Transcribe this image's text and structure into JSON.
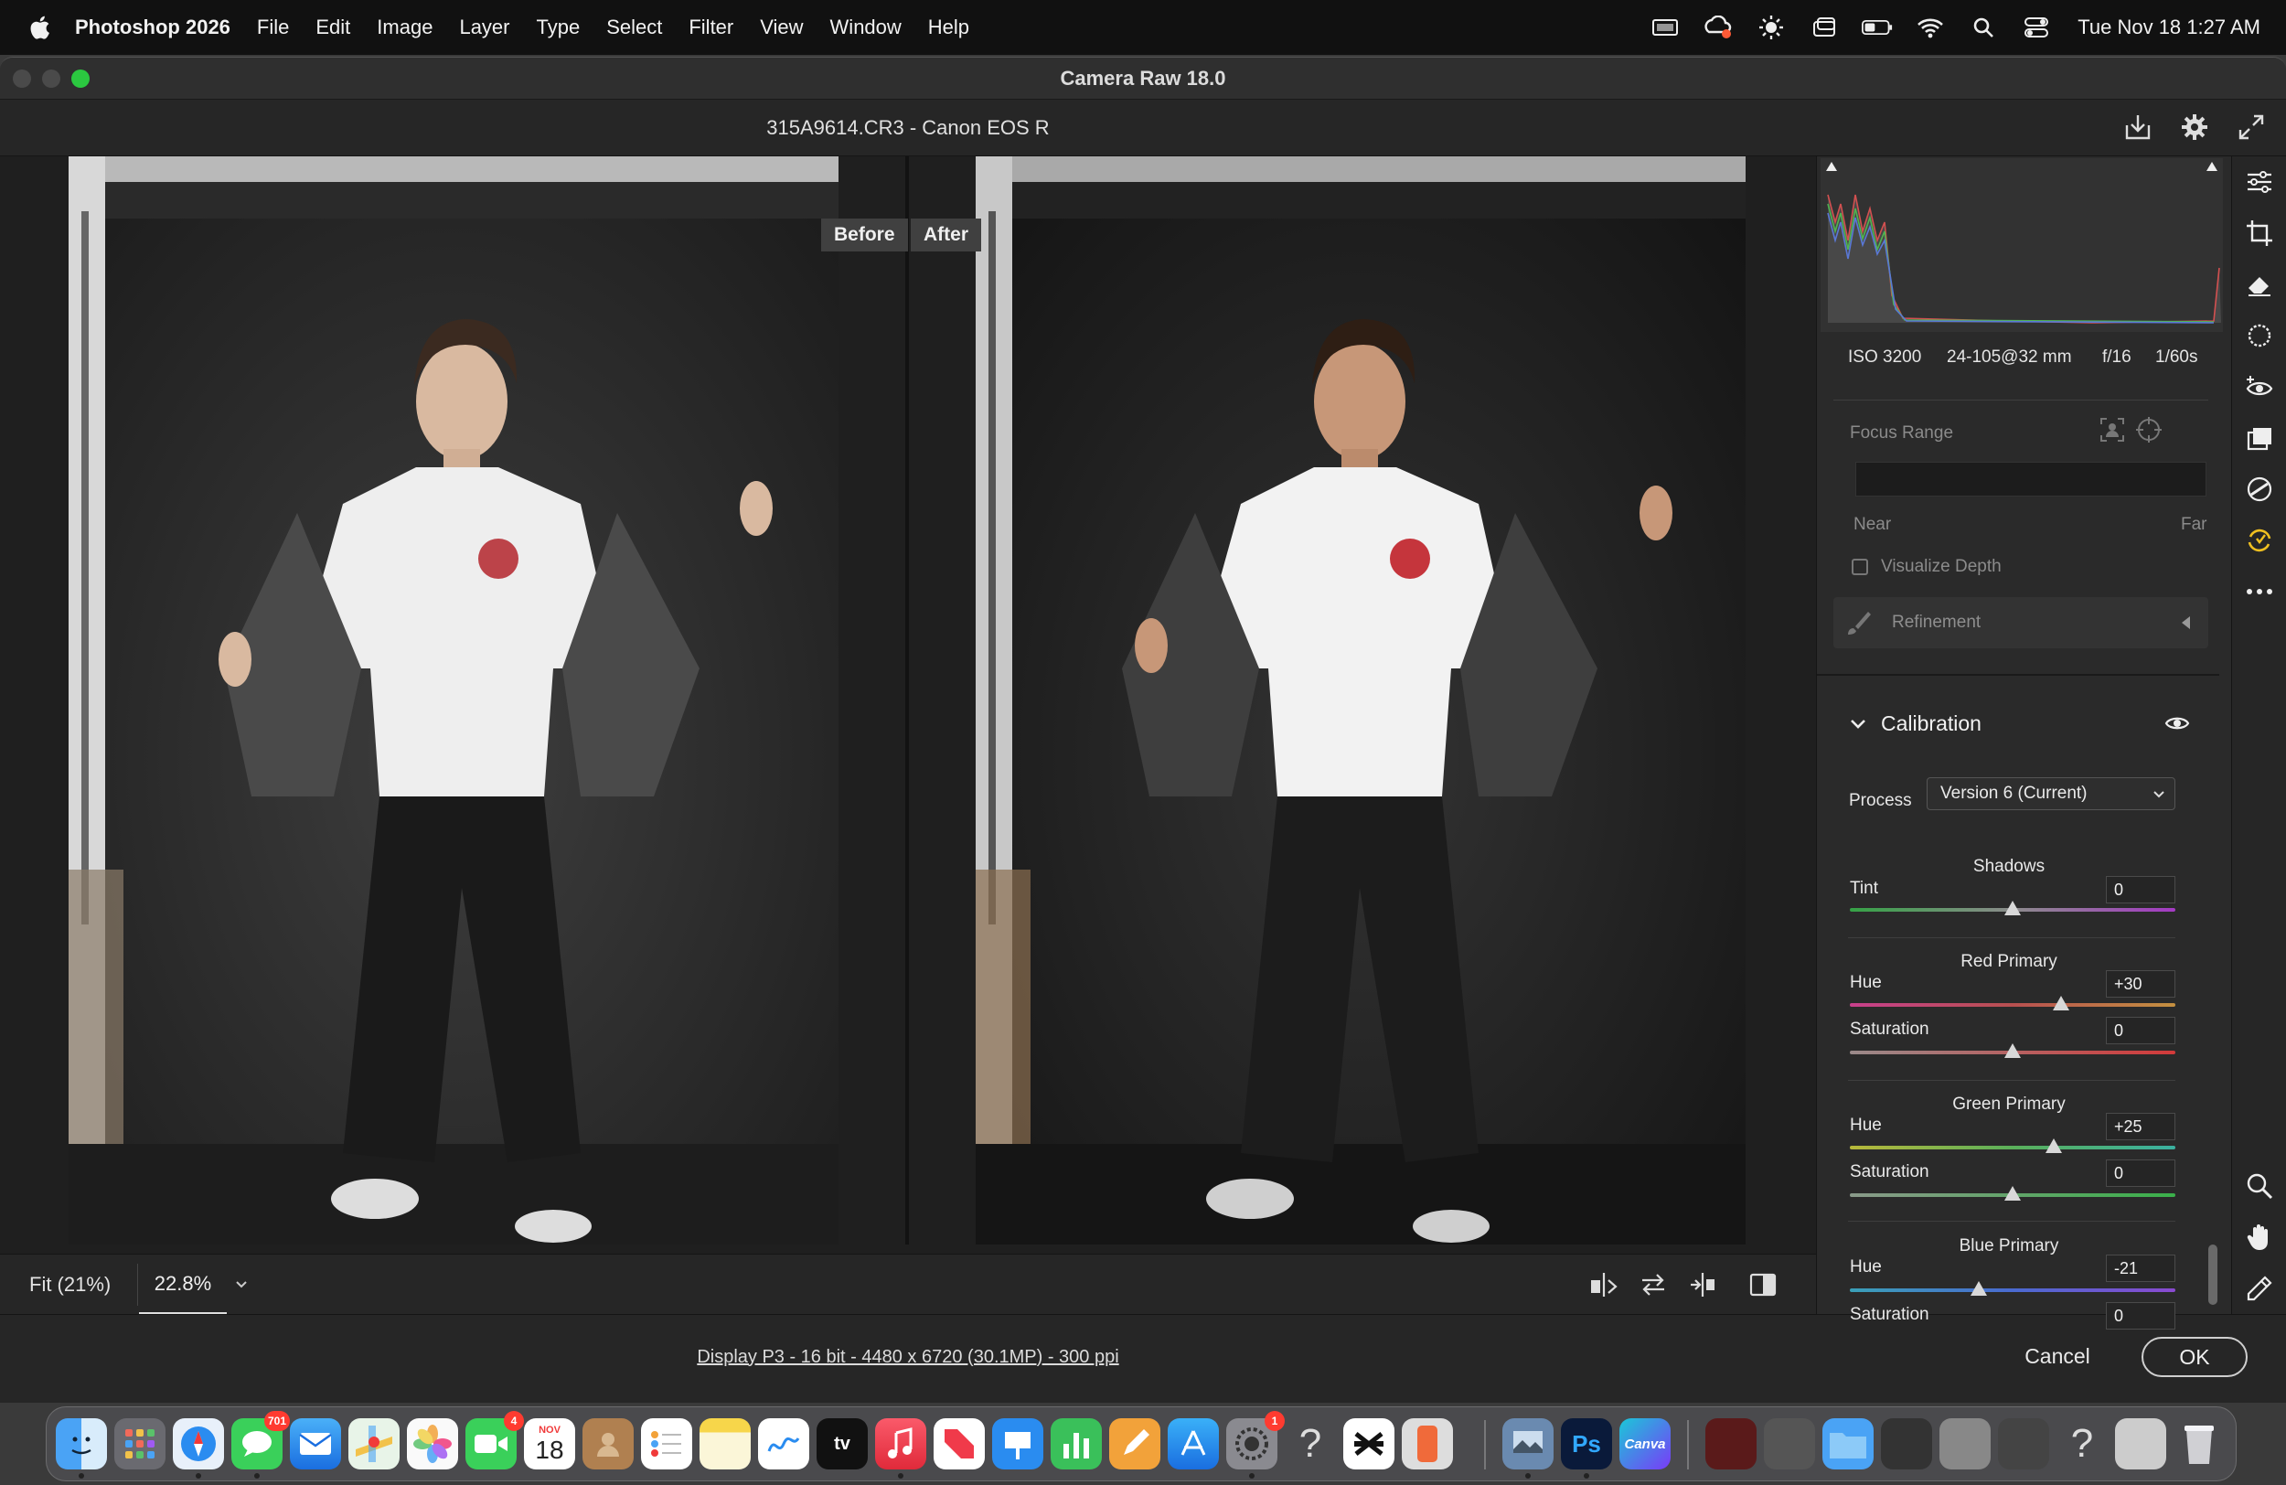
{
  "menubar": {
    "app_name": "Photoshop 2026",
    "items": [
      "File",
      "Edit",
      "Image",
      "Layer",
      "Type",
      "Select",
      "Filter",
      "View",
      "Window",
      "Help"
    ],
    "clock": "Tue Nov 18  1:27 AM",
    "status_icons": [
      "display-icon",
      "creative-cloud-icon",
      "brightness-icon",
      "window-icon",
      "battery-icon",
      "wifi-icon",
      "search-icon",
      "control-center-icon"
    ]
  },
  "window": {
    "title": "Camera Raw 18.0",
    "file_label": "315A9614.CR3  -  Canon EOS R"
  },
  "preview": {
    "before_label": "Before",
    "after_label": "After"
  },
  "zoom": {
    "fit_label": "Fit (21%)",
    "value": "22.8%"
  },
  "footer": {
    "display_info": "Display P3 - 16 bit - 4480 x 6720 (30.1MP) - 300 ppi",
    "cancel_label": "Cancel",
    "ok_label": "OK"
  },
  "exif": {
    "iso": "ISO 3200",
    "lens": "24-105@32 mm",
    "aperture": "f/16",
    "shutter": "1/60s"
  },
  "depth": {
    "focus_range_label": "Focus Range",
    "near_label": "Near",
    "far_label": "Far",
    "visualize_depth_label": "Visualize Depth",
    "visualize_depth_checked": false,
    "refinement_label": "Refinement"
  },
  "calibration": {
    "title": "Calibration",
    "process_label": "Process",
    "process_value": "Version 6 (Current)",
    "shadows": {
      "title": "Shadows",
      "tint_label": "Tint",
      "tint_value": "0"
    },
    "red": {
      "title": "Red Primary",
      "hue_label": "Hue",
      "hue_value": "+30",
      "sat_label": "Saturation",
      "sat_value": "0"
    },
    "green": {
      "title": "Green Primary",
      "hue_label": "Hue",
      "hue_value": "+25",
      "sat_label": "Saturation",
      "sat_value": "0"
    },
    "blue": {
      "title": "Blue Primary",
      "hue_label": "Hue",
      "hue_value": "-21",
      "sat_label": "Saturation",
      "sat_value": "0"
    }
  },
  "sliders": {
    "shadows_tint": 0,
    "red_hue": 30,
    "red_sat": 0,
    "green_hue": 25,
    "green_sat": 0,
    "blue_hue": -21,
    "blue_sat": 0,
    "range": [
      -100,
      100
    ]
  },
  "dock": {
    "badges": {
      "messages": "701",
      "facetime": "4",
      "system_settings": "1"
    },
    "calendar_month": "NOV",
    "calendar_day": "18",
    "ps_label": "Ps",
    "canva_label": "Canva",
    "tv_label": "tv"
  },
  "colors": {
    "accent_green": "#2bc840",
    "panel_bg": "#2a2a2a",
    "badge_red": "#ff3b30"
  }
}
